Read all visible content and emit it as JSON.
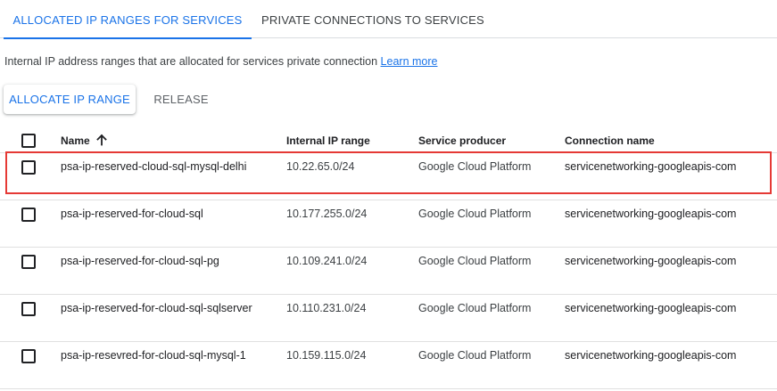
{
  "tabs": [
    {
      "label": "ALLOCATED IP RANGES FOR SERVICES",
      "active": true
    },
    {
      "label": "PRIVATE CONNECTIONS TO SERVICES",
      "active": false
    }
  ],
  "description": {
    "text": "Internal IP address ranges that are allocated for services private connection",
    "link": "Learn more"
  },
  "toolbar": {
    "allocate_label": "ALLOCATE IP RANGE",
    "release_label": "RELEASE"
  },
  "table": {
    "headers": {
      "name": "Name",
      "ip": "Internal IP range",
      "producer": "Service producer",
      "connection": "Connection name"
    },
    "sort": {
      "column": "name",
      "direction": "ascending",
      "icon": "arrow-up-icon"
    },
    "rows": [
      {
        "name": "psa-ip-reserved-cloud-sql-mysql-delhi",
        "ip": "10.22.65.0/24",
        "producer": "Google Cloud Platform",
        "connection": "servicenetworking-googleapis-com",
        "highlighted": true
      },
      {
        "name": "psa-ip-reserved-for-cloud-sql",
        "ip": "10.177.255.0/24",
        "producer": "Google Cloud Platform",
        "connection": "servicenetworking-googleapis-com"
      },
      {
        "name": "psa-ip-reserved-for-cloud-sql-pg",
        "ip": "10.109.241.0/24",
        "producer": "Google Cloud Platform",
        "connection": "servicenetworking-googleapis-com"
      },
      {
        "name": "psa-ip-reserved-for-cloud-sql-sqlserver",
        "ip": "10.110.231.0/24",
        "producer": "Google Cloud Platform",
        "connection": "servicenetworking-googleapis-com"
      },
      {
        "name": "psa-ip-resevred-for-cloud-sql-mysql-1",
        "ip": "10.159.115.0/24",
        "producer": "Google Cloud Platform",
        "connection": "servicenetworking-googleapis-com"
      }
    ]
  },
  "colors": {
    "accent": "#1a73e8",
    "highlight_border": "#e53935",
    "divider": "#e0e0e0"
  }
}
